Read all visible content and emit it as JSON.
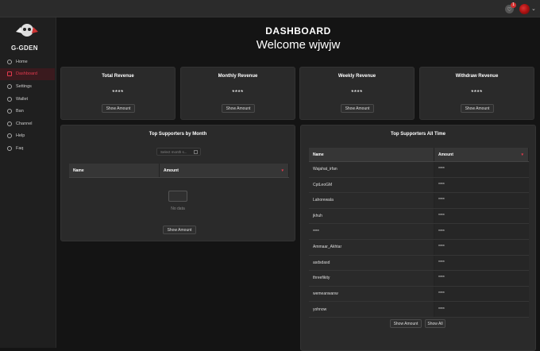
{
  "topbar": {
    "notification_count": "1"
  },
  "logo": {
    "text": "G-GDEN"
  },
  "sidebar": {
    "items": [
      {
        "label": "Home",
        "icon": "home-icon"
      },
      {
        "label": "Dashboard",
        "icon": "dashboard-icon",
        "active": true
      },
      {
        "label": "Settings",
        "icon": "gear-icon"
      },
      {
        "label": "Wallet",
        "icon": "wallet-icon"
      },
      {
        "label": "Ban",
        "icon": "ban-icon"
      },
      {
        "label": "Channel",
        "icon": "video-icon"
      },
      {
        "label": "Help",
        "icon": "help-icon"
      },
      {
        "label": "Faq",
        "icon": "faq-icon"
      }
    ]
  },
  "header": {
    "title": "DASHBOARD",
    "welcome": "Welcome wjwjw"
  },
  "cards": [
    {
      "title": "Total Revenue",
      "value": "****",
      "button": "Show Amount"
    },
    {
      "title": "Monthly Revenue",
      "value": "****",
      "button": "Show Amount"
    },
    {
      "title": "Weekly Revenue",
      "value": "****",
      "button": "Show Amount"
    },
    {
      "title": "Withdraw Revenue",
      "value": "****",
      "button": "Show Amount"
    }
  ],
  "by_month": {
    "title": "Top Supporters by Month",
    "date_placeholder": "Select month s...",
    "columns": [
      "Name",
      "Amount"
    ],
    "empty_text": "No data",
    "button": "Show Amount"
  },
  "all_time": {
    "title": "Top Supporters All Time",
    "columns": [
      "Name",
      "Amount"
    ],
    "rows": [
      {
        "name": "Wajahat_irfan",
        "amount": "****"
      },
      {
        "name": "CptLeoGM",
        "amount": "****"
      },
      {
        "name": "Lahorewala",
        "amount": "****"
      },
      {
        "name": "jkhuh",
        "amount": "****"
      },
      {
        "name": "****",
        "amount": "****"
      },
      {
        "name": "Ammaar_Akhtar",
        "amount": "****"
      },
      {
        "name": "asdsdasd",
        "amount": "****"
      },
      {
        "name": "threefikity",
        "amount": "****"
      },
      {
        "name": "wemeanwanw",
        "amount": "****"
      },
      {
        "name": "yohnow",
        "amount": "****"
      }
    ],
    "show_amount_button": "Show Amount",
    "show_all_button": "Show All"
  },
  "colors": {
    "accent": "#e23a4e",
    "background": "#141414",
    "card": "#2a2a2a"
  }
}
